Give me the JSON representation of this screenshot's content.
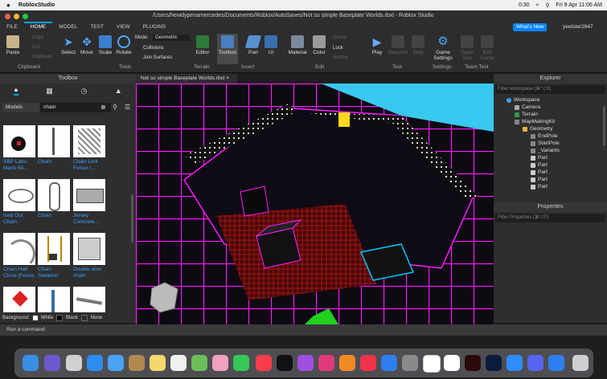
{
  "mac": {
    "app": "RobloxStudio",
    "time": "0:30",
    "clock": "Fri 9 Apr  11:06 AM"
  },
  "title": "/Users/hewdypenamercedes/Documents/Roblox/AutoSaves/Not so simple Baseplate Worlds.rbxl - Roblox Studio",
  "tabs": [
    "FILE",
    "HOME",
    "MODEL",
    "TEST",
    "VIEW",
    "PLUGINS"
  ],
  "whats_new": "What's New",
  "user": "yeetster2947",
  "ribbon": {
    "paste": "Paste",
    "copy": "Copy",
    "cut": "Cut",
    "duplicate": "Duplicate",
    "clipboard": "Clipboard",
    "select": "Select",
    "move": "Move",
    "scale": "Scale",
    "rotate": "Rotate",
    "mode_label": "Mode:",
    "mode_value": "Geometric",
    "collisions": "Collisions",
    "join": "Join Surfaces",
    "tools": "Tools",
    "editor": "Editor",
    "toolbox": "Toolbox",
    "terrain": "Terrain",
    "part": "Part",
    "ui": "UI",
    "insert": "Insert",
    "material": "Material",
    "color": "Color",
    "group": "Group",
    "lock": "Lock",
    "anchor": "Anchor",
    "edit": "Edit",
    "play": "Play",
    "resume": "Resume",
    "stop": "Stop",
    "test": "Test",
    "game_settings": "Game Settings",
    "settings": "Settings",
    "team_test": "Team Test",
    "exit_game": "Exit Game",
    "team_test_grp": "Team Test"
  },
  "toolbox": {
    "title": "Toolbox",
    "category": "Models",
    "search": "chain",
    "items": [
      {
        "label": "SBP Labs-Mario 64..."
      },
      {
        "label": "Chain"
      },
      {
        "label": "Chain Link Fense /..."
      },
      {
        "label": "Iced Out Chain"
      },
      {
        "label": "Chain"
      },
      {
        "label": "Jersey Concrete..."
      },
      {
        "label": "Chain Half Circle [Fence"
      },
      {
        "label": "Chain Skeleton"
      },
      {
        "label": "Double door chain"
      },
      {
        "label": ""
      },
      {
        "label": ""
      },
      {
        "label": ""
      }
    ],
    "background_label": "Background:",
    "bg_white": "White",
    "bg_black": "Black",
    "bg_none": "None"
  },
  "viewport_tab": "Not so simple Baseplate Worlds.rbxl",
  "explorer": {
    "title": "Explorer",
    "filter": "Filter workspace (⌘⌥X)",
    "nodes": [
      "Workspace",
      "Camera",
      "Terrain",
      "MapMakingKit",
      "Geometry",
      "EndPole",
      "StartPole",
      "_Variants",
      "Part",
      "Part",
      "Part",
      "Part",
      "Part"
    ]
  },
  "properties": {
    "title": "Properties",
    "filter": "Filter Properties (⌘⇧P)"
  },
  "command": "Run a command",
  "colors": {
    "accent": "#00a2ff",
    "neon": "#ff00ff",
    "panel": "#2e2e2e"
  }
}
